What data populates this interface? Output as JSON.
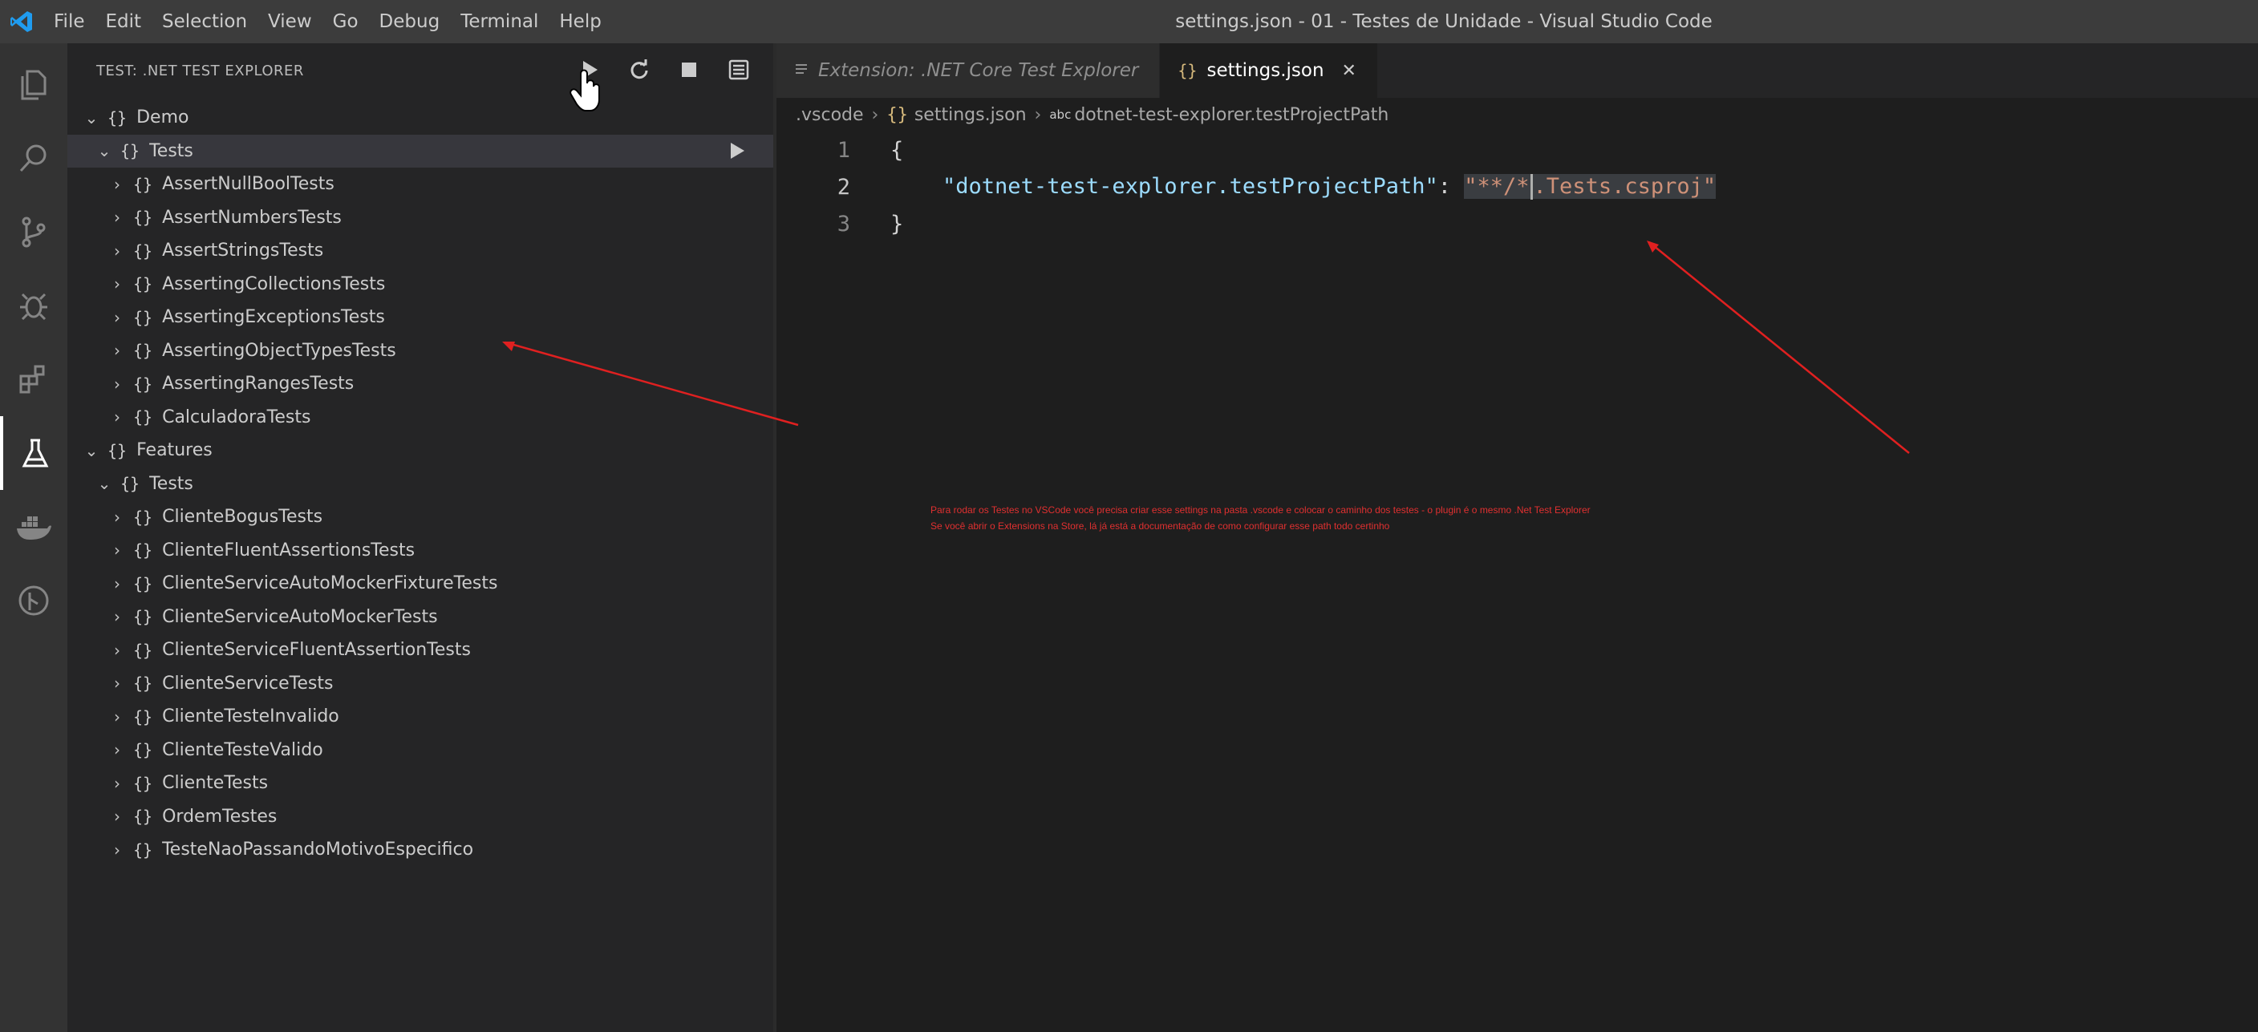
{
  "window": {
    "title": "settings.json - 01 - Testes de Unidade - Visual Studio Code"
  },
  "menu": [
    "File",
    "Edit",
    "Selection",
    "View",
    "Go",
    "Debug",
    "Terminal",
    "Help"
  ],
  "activity_bar": [
    "explorer-icon",
    "search-icon",
    "source-control-icon",
    "debug-icon",
    "extensions-icon",
    "test-flask-icon",
    "docker-icon",
    "gitlens-icon"
  ],
  "sidebar": {
    "title": "TEST: .NET TEST EXPLORER",
    "actions": [
      "run-all-icon",
      "refresh-icon",
      "stop-icon",
      "log-icon"
    ],
    "tree": [
      {
        "label": "Demo",
        "depth": 0,
        "expanded": true
      },
      {
        "label": "Tests",
        "depth": 1,
        "expanded": true
      },
      {
        "label": "AssertNullBoolTests",
        "depth": 2
      },
      {
        "label": "AssertNumbersTests",
        "depth": 2
      },
      {
        "label": "AssertStringsTests",
        "depth": 2
      },
      {
        "label": "AssertingCollectionsTests",
        "depth": 2
      },
      {
        "label": "AssertingExceptionsTests",
        "depth": 2
      },
      {
        "label": "AssertingObjectTypesTests",
        "depth": 2
      },
      {
        "label": "AssertingRangesTests",
        "depth": 2
      },
      {
        "label": "CalculadoraTests",
        "depth": 2
      },
      {
        "label": "Features",
        "depth": 0,
        "expanded": true
      },
      {
        "label": "Tests",
        "depth": 1,
        "expanded": true
      },
      {
        "label": "ClienteBogusTests",
        "depth": 2
      },
      {
        "label": "ClienteFluentAssertionsTests",
        "depth": 2
      },
      {
        "label": "ClienteServiceAutoMockerFixtureTests",
        "depth": 2
      },
      {
        "label": "ClienteServiceAutoMockerTests",
        "depth": 2
      },
      {
        "label": "ClienteServiceFluentAssertionTests",
        "depth": 2
      },
      {
        "label": "ClienteServiceTests",
        "depth": 2
      },
      {
        "label": "ClienteTesteInvalido",
        "depth": 2
      },
      {
        "label": "ClienteTesteValido",
        "depth": 2
      },
      {
        "label": "ClienteTests",
        "depth": 2
      },
      {
        "label": "OrdemTestes",
        "depth": 2
      },
      {
        "label": "TesteNaoPassandoMotivoEspecifico",
        "depth": 2
      }
    ]
  },
  "tabs": [
    {
      "label": "Extension: .NET Core Test Explorer",
      "active": false
    },
    {
      "label": "settings.json",
      "active": true
    }
  ],
  "breadcrumb": {
    "folder": ".vscode",
    "file": "settings.json",
    "symbol": "dotnet-test-explorer.testProjectPath"
  },
  "editor": {
    "line_numbers": [
      "1",
      "2",
      "3"
    ],
    "open_brace": "{",
    "key": "\"dotnet-test-explorer.testProjectPath\"",
    "colon": ": ",
    "value_before_cursor": "\"**/*",
    "value_after_cursor": ".Tests.csproj\"",
    "close_brace": "}"
  },
  "annotation": {
    "line1": "Para rodar os Testes no VSCode você precisa criar esse settings na pasta .vscode e colocar o caminho dos testes - o plugin é o mesmo .Net Test Explorer",
    "line2": "Se você abrir o Extensions na Store, lá já está a documentação de como configurar esse path todo certinho"
  }
}
